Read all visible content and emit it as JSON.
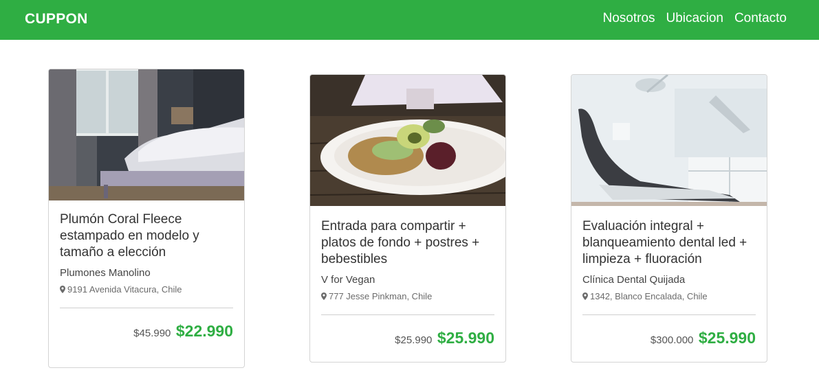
{
  "navbar": {
    "brand": "CUPPON",
    "links": [
      "Nosotros",
      "Ubicacion",
      "Contacto"
    ],
    "bg_color": "#2fae43"
  },
  "cards": [
    {
      "image": "bedroom-bed-photo",
      "title": "Plumón Coral Fleece estampado en modelo y tamaño a elección",
      "vendor": "Plumones Manolino",
      "address": "9191 Avenida Vitacura, Chile",
      "old_price": "$45.990",
      "new_price": "$22.990"
    },
    {
      "image": "vegan-food-plate-photo",
      "title": "Entrada para compartir + platos de fondo + postres + bebestibles",
      "vendor": "V for Vegan",
      "address": "777 Jesse Pinkman, Chile",
      "old_price": "$25.990",
      "new_price": "$25.990"
    },
    {
      "image": "dental-chair-photo",
      "title": "Evaluación integral + blanqueamiento dental led + limpieza + fluoración",
      "vendor": "Clínica Dental Quijada",
      "address": "1342, Blanco Encalada, Chile",
      "old_price": "$300.000",
      "new_price": "$25.990"
    }
  ],
  "colors": {
    "accent": "#2fae43",
    "price": "#2fae43"
  },
  "icons": {
    "address": "map-pin-icon"
  }
}
